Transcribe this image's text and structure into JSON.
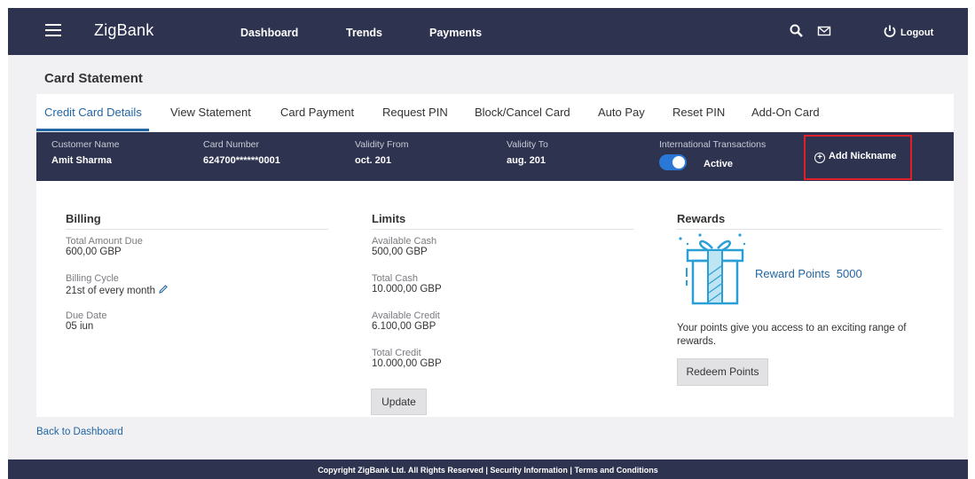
{
  "header": {
    "brand": "ZigBank",
    "nav": [
      "Dashboard",
      "Trends",
      "Payments"
    ],
    "logout": "Logout"
  },
  "page": {
    "title": "Card Statement"
  },
  "tabs": [
    "Credit Card Details",
    "View Statement",
    "Card Payment",
    "Request PIN",
    "Block/Cancel Card",
    "Auto Pay",
    "Reset PIN",
    "Add-On Card"
  ],
  "card_info": {
    "customer_name_label": "Customer Name",
    "customer_name": "Amit Sharma",
    "card_number_label": "Card Number",
    "card_number": "624700******0001",
    "validity_from_label": "Validity From",
    "validity_from": "oct. 201",
    "validity_to_label": "Validity To",
    "validity_to": "aug. 201",
    "intl_label": "International Transactions",
    "intl_status": "Active",
    "add_nickname": "Add Nickname"
  },
  "billing": {
    "title": "Billing",
    "total_due_label": "Total Amount Due",
    "total_due": "600,00 GBP",
    "cycle_label": "Billing Cycle",
    "cycle": "21st of every month",
    "due_date_label": "Due Date",
    "due_date": "05 iun"
  },
  "limits": {
    "title": "Limits",
    "avail_cash_label": "Available Cash",
    "avail_cash": "500,00 GBP",
    "total_cash_label": "Total Cash",
    "total_cash": "10.000,00 GBP",
    "avail_credit_label": "Available Credit",
    "avail_credit": "6.100,00 GBP",
    "total_credit_label": "Total Credit",
    "total_credit": "10.000,00 GBP",
    "update_button": "Update"
  },
  "rewards": {
    "title": "Rewards",
    "points_label": "Reward Points",
    "points": "5000",
    "description": "Your points give you access to an exciting range of rewards.",
    "redeem_button": "Redeem Points"
  },
  "back_link": "Back to Dashboard",
  "footer": {
    "copyright": "Copyright ZigBank Ltd. All Rights Reserved",
    "security": "Security Information",
    "terms": "Terms and Conditions"
  },
  "colors": {
    "navbar": "#2e3350",
    "accent": "#2266a3",
    "highlight": "#e0202a",
    "toggle": "#2a78d6"
  }
}
